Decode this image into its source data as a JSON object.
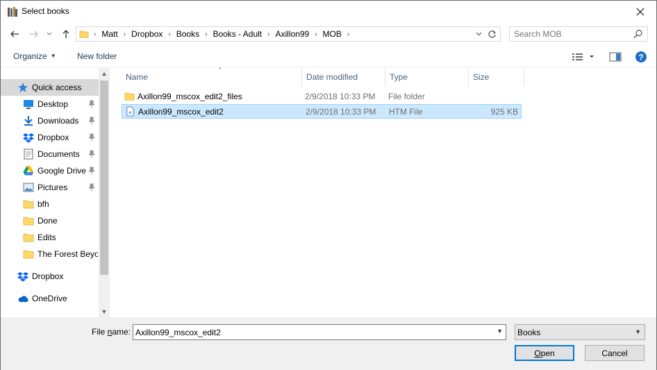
{
  "window": {
    "title": "Select books"
  },
  "nav": {
    "back_icon": "arrow-left-icon",
    "forward_icon": "arrow-right-icon",
    "recent_icon": "chevron-down-icon",
    "up_icon": "arrow-up-icon"
  },
  "address": {
    "crumbs": [
      "Matt",
      "Dropbox",
      "Books",
      "Books - Adult",
      "Axillon99",
      "MOB"
    ]
  },
  "search": {
    "placeholder": "Search MOB"
  },
  "toolbar": {
    "organize_label": "Organize",
    "new_folder_label": "New folder"
  },
  "sidebar": {
    "items": [
      {
        "label": "Quick access",
        "icon": "star-icon",
        "selected": true,
        "pinned": false
      },
      {
        "label": "Desktop",
        "icon": "desktop-icon",
        "pinned": true
      },
      {
        "label": "Downloads",
        "icon": "download-icon",
        "pinned": true
      },
      {
        "label": "Dropbox",
        "icon": "dropbox-icon",
        "pinned": true
      },
      {
        "label": "Documents",
        "icon": "documents-icon",
        "pinned": true
      },
      {
        "label": "Google Drive",
        "icon": "google-drive-icon",
        "pinned": true
      },
      {
        "label": "Pictures",
        "icon": "pictures-icon",
        "pinned": true
      },
      {
        "label": "bfh",
        "icon": "folder-icon",
        "pinned": false
      },
      {
        "label": "Done",
        "icon": "folder-icon",
        "pinned": false
      },
      {
        "label": "Edits",
        "icon": "folder-icon",
        "pinned": false
      },
      {
        "label": "The Forest Beyond",
        "icon": "folder-icon",
        "pinned": false
      },
      {
        "label": "Dropbox",
        "icon": "dropbox-icon",
        "pinned": false
      },
      {
        "label": "OneDrive",
        "icon": "onedrive-icon",
        "pinned": false
      }
    ]
  },
  "filelist": {
    "columns": [
      "Name",
      "Date modified",
      "Type",
      "Size"
    ],
    "rows": [
      {
        "name": "Axillon99_mscox_edit2_files",
        "date": "2/9/2018 10:33 PM",
        "type": "File folder",
        "size": "",
        "icon": "folder-icon",
        "selected": false
      },
      {
        "name": "Axillon99_mscox_edit2",
        "date": "2/9/2018 10:33 PM",
        "type": "HTM File",
        "size": "925 KB",
        "icon": "htm-file-icon",
        "selected": true
      }
    ]
  },
  "footer": {
    "filename_label_pre": "File ",
    "filename_label_u": "n",
    "filename_label_post": "ame:",
    "filename_value": "Axillon99_mscox_edit2",
    "filetype_value": "Books",
    "open_label_u": "O",
    "open_label_rest": "pen",
    "cancel_label": "Cancel"
  },
  "colors": {
    "accent": "#0078d7",
    "selection": "#cce8ff",
    "folder": "#ffd868"
  }
}
